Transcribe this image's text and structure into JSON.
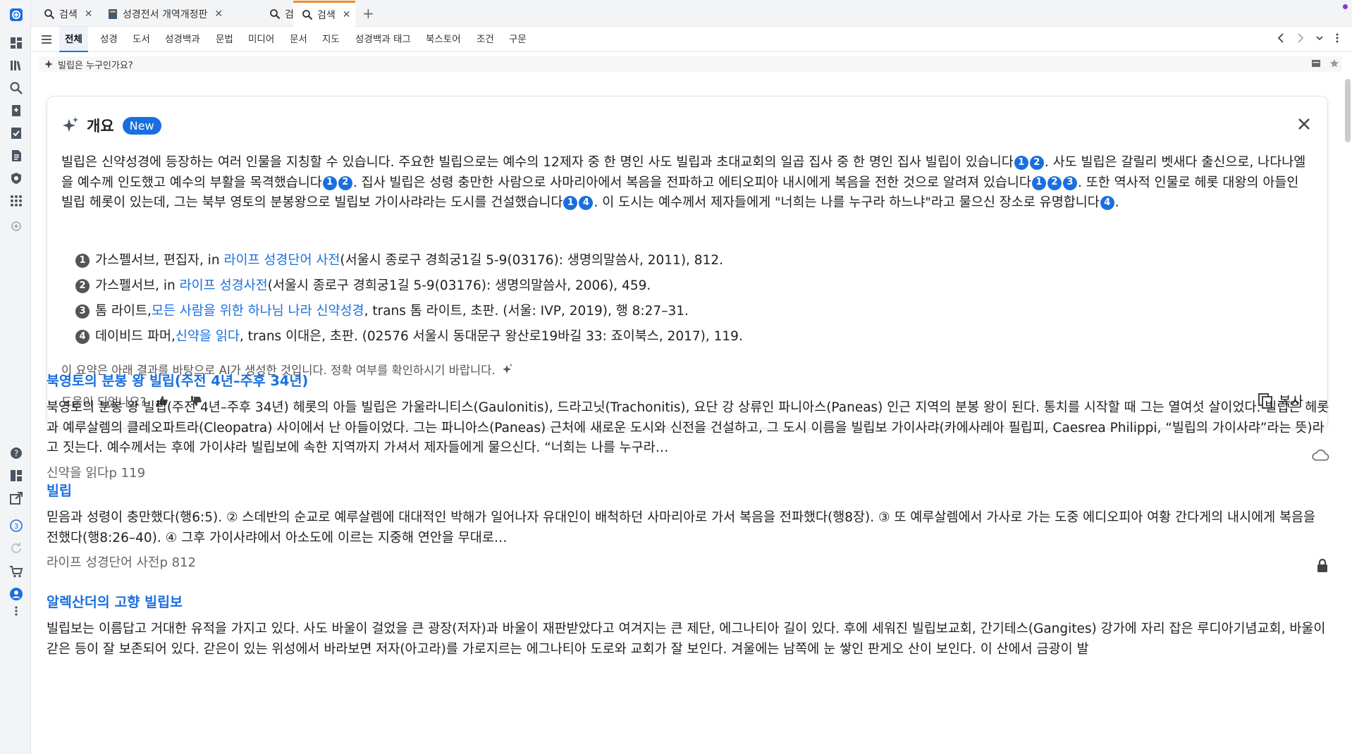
{
  "tabs": [
    {
      "icon": "search-icon",
      "label": "검색"
    },
    {
      "icon": "book-icon",
      "label": "성경전서 개역개정판"
    },
    {
      "icon": "search-icon",
      "label": "검색"
    },
    {
      "icon": "search-icon",
      "label": "검색"
    }
  ],
  "tab_close": "✕",
  "new_tab": "+",
  "filters": [
    "전체",
    "성경",
    "도서",
    "성경백과",
    "문법",
    "미디어",
    "문서",
    "지도",
    "성경백과 태그",
    "북스토어",
    "조건",
    "구문"
  ],
  "query": "빌립은 누구인가요?",
  "overview": {
    "title": "개요",
    "badge": "New",
    "summary": [
      {
        "t": "빌립은 신약성경에 등장하는 여러 인물을 지칭할 수 있습니다. 주요한 빌립으로는 예수의 12제자 중 한 명인 사도 빌립과 초대교회의 일곱 집사 중 한 명인 집사 빌립이 있습니다"
      },
      {
        "n": [
          "1",
          "2"
        ]
      },
      {
        "t": ". 사도 빌립은 갈릴리 벳새다 출신으로, 나다나엘을 예수께 인도했고 예수의 부활을 목격했습니다"
      },
      {
        "n": [
          "1",
          "2"
        ]
      },
      {
        "t": ". 집사 빌립은 성령 충만한 사람으로 사마리아에서 복음을 전파하고 에티오피아 내시에게 복음을 전한 것으로 알려져 있습니다"
      },
      {
        "n": [
          "1",
          "2",
          "3"
        ]
      },
      {
        "t": ". 또한 역사적 인물로 헤롯 대왕의 아들인 빌립 헤롯이 있는데, 그는 북부 영토의 분봉왕으로 빌립보 가이사랴라는 도시를 건설했습니다"
      },
      {
        "n": [
          "1",
          "4"
        ]
      },
      {
        "t": ". 이 도시는 예수께서 제자들에게 \"너희는 나를 누구라 하느냐\"라고 물으신 장소로 유명합니다"
      },
      {
        "n": [
          "4"
        ]
      },
      {
        "t": "."
      }
    ],
    "references": [
      {
        "num": "1",
        "pre": "가스펠서브, 편집자, in ",
        "link": "라이프 성경단어 사전",
        "post": " (서울시 종로구 경희궁1길 5-9(03176): 생명의말씀사, 2011), 812."
      },
      {
        "num": "2",
        "pre": "가스펠서브, in ",
        "link": "라이프 성경사전",
        "post": " (서울시 종로구 경희궁1길 5-9(03176): 생명의말씀사, 2006), 459."
      },
      {
        "num": "3",
        "pre": "톰 라이트, ",
        "link": "모든 사람을 위한 하나님 나라 신약성경",
        "post": ", trans 톰 라이트, 초판. (서울: IVP, 2019), 행 8:27–31."
      },
      {
        "num": "4",
        "pre": "데이비드 파머, ",
        "link": "신약을 읽다",
        "post": ", trans 이대은, 초판. (02576 서울시 동대문구 왕산로19바길 33: 죠이북스, 2017), 119."
      }
    ],
    "disclaimer": "이 요약은 아래 결과를 바탕으로 AI가 생성한 것입니다. 정확 여부를 확인하시기 바랍니다.",
    "helpful": "도움이 되었나요?",
    "copy": "복사"
  },
  "results": [
    {
      "title": "북영토의 분봉 왕 빌립(주전 4년–주후 34년)",
      "body": "북영토의 분봉 왕 빌립(주전 4년–주후 34년) 헤롯의 아들 빌립은 가울라니티스(Gaulonitis), 드라고닛(Trachonitis), 요단 강 상류인 파니아스(Paneas) 인근 지역의 분봉 왕이 된다. 통치를 시작할 때 그는 열여섯 살이었다. 빌립은 헤롯과 예루살렘의 클레오파트라(Cleopatra) 사이에서 난 아들이었다. 그는 파니아스(Paneas) 근처에 새로운 도시와 신전을 건설하고, 그 도시 이름을 빌립보 가이사랴(카에사레아 필립피, Caesrea Philippi, “빌립의 가이사랴”라는 뜻)라고 짓는다. 예수께서는 후에 가이샤라 빌립보에 속한 지역까지 가셔서 제자들에게 물으신다. “너희는 나를 누구라…",
      "source": "신약을 읽다p 119",
      "icon": "cloud-icon"
    },
    {
      "title": "빌립",
      "body": "믿음과 성령이 충만했다(행6:5). ② 스데반의 순교로 예루살렘에 대대적인 박해가 일어나자 유대인이 배척하던 사마리아로 가서 복음을 전파했다(행8장). ③ 또 예루살렘에서 가사로 가는 도중 에디오피아 여황 간다게의 내시에게 복음을 전했다(행8:26–40). ④ 그후 가이사랴에서 아소도에 이르는 지중해 연안을 무대로…",
      "source": "라이프 성경단어 사전p 812",
      "icon": "lock-icon"
    },
    {
      "title": "알렉산더의 고향 빌립보",
      "body": "빌립보는 이름답고 거대한 유적을 가지고 있다. 사도 바울이 걸었을 큰 광장(저자)과 바울이 재판받았다고 여겨지는 큰 제단, 에그나티아 길이 있다. 후에 세워진 빌립보교회, 간기테스(Gangites) 강가에 자리 잡은 루디아기념교회, 바울이 갇은 등이 잘 보존되어 있다. 갇은이 있는 위성에서 바라보면 저자(아고라)를 가로지르는 에그나티아 도로와 교회가 잘 보인다. 겨울에는 남쪽에 눈 쌓인 판게오 산이 보인다. 이 산에서 금광이 발",
      "source": "",
      "icon": ""
    }
  ],
  "colors": {
    "accent": "#1a6fe0",
    "tab_active": "#f08c2b"
  }
}
